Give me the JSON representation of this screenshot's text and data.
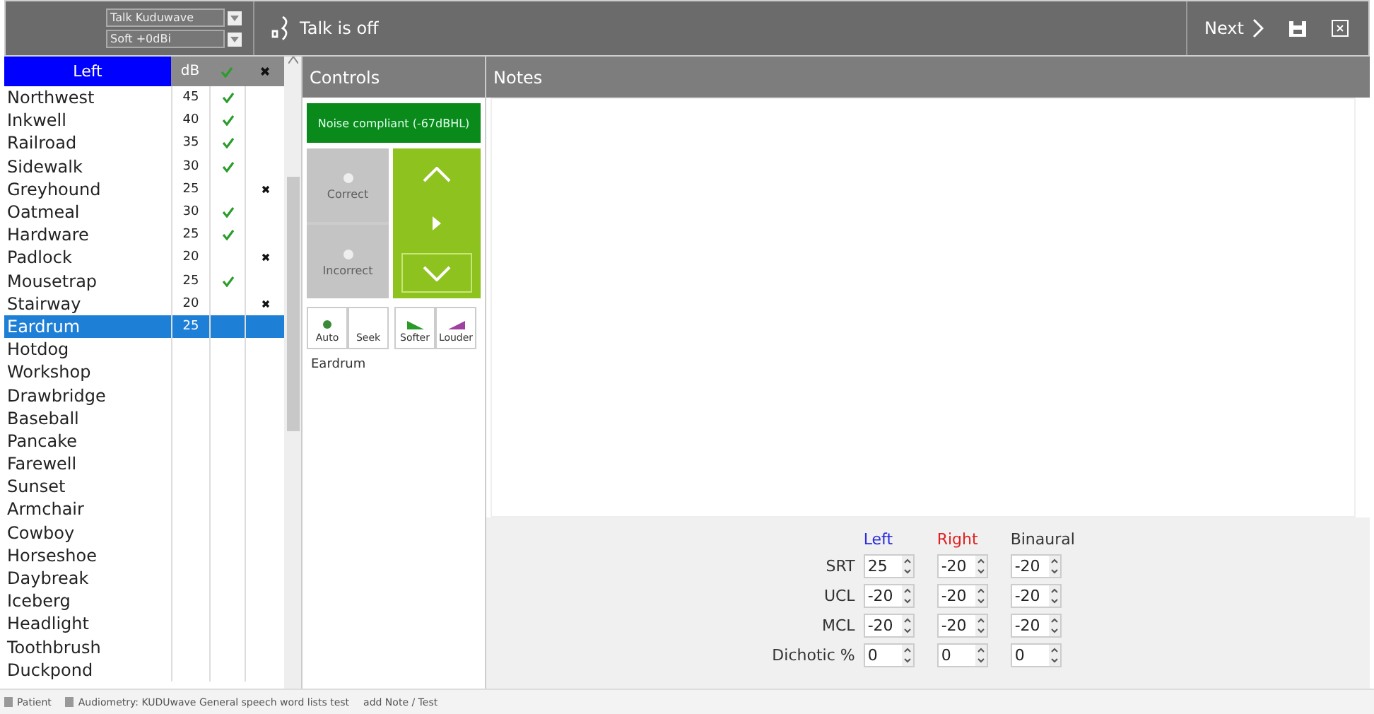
{
  "toolbar": {
    "dropdowns": [
      {
        "value": "Talk Kuduwave"
      },
      {
        "value": "Soft +0dBi"
      }
    ],
    "talk_status": "Talk is off",
    "next": "Next"
  },
  "word_list": {
    "ear": "Left",
    "db_column": "dB",
    "rows": [
      {
        "word": "Northwest",
        "db": "45",
        "correct": true,
        "selected": false
      },
      {
        "word": "Inkwell",
        "db": "40",
        "correct": true,
        "selected": false
      },
      {
        "word": "Railroad",
        "db": "35",
        "correct": true,
        "selected": false
      },
      {
        "word": "Sidewalk",
        "db": "30",
        "correct": true,
        "selected": false
      },
      {
        "word": "Greyhound",
        "db": "25",
        "correct": false,
        "selected": false
      },
      {
        "word": "Oatmeal",
        "db": "30",
        "correct": true,
        "selected": false
      },
      {
        "word": "Hardware",
        "db": "25",
        "correct": true,
        "selected": false
      },
      {
        "word": "Padlock",
        "db": "20",
        "correct": false,
        "selected": false
      },
      {
        "word": "Mousetrap",
        "db": "25",
        "correct": true,
        "selected": false
      },
      {
        "word": "Stairway",
        "db": "20",
        "correct": false,
        "selected": false
      },
      {
        "word": "Eardrum",
        "db": "25",
        "selected": true
      },
      {
        "word": "Hotdog",
        "selected": false
      },
      {
        "word": "Workshop",
        "selected": false
      },
      {
        "word": "Drawbridge",
        "selected": false
      },
      {
        "word": "Baseball",
        "selected": false
      },
      {
        "word": "Pancake",
        "selected": false
      },
      {
        "word": "Farewell",
        "selected": false
      },
      {
        "word": "Sunset",
        "selected": false
      },
      {
        "word": "Armchair",
        "selected": false
      },
      {
        "word": "Cowboy",
        "selected": false
      },
      {
        "word": "Horseshoe",
        "selected": false
      },
      {
        "word": "Daybreak",
        "selected": false
      },
      {
        "word": "Iceberg",
        "selected": false
      },
      {
        "word": "Headlight",
        "selected": false
      },
      {
        "word": "Toothbrush",
        "selected": false
      },
      {
        "word": "Duckpond",
        "selected": false
      }
    ]
  },
  "controls": {
    "title": "Controls",
    "noise_status": "Noise compliant (-67dBHL)",
    "answer_buttons": [
      {
        "label": "Correct",
        "disabled": true
      },
      {
        "label": "Incorrect",
        "disabled": true
      }
    ],
    "modes": [
      {
        "label": "Auto"
      },
      {
        "label": "Seek"
      }
    ],
    "levels": [
      {
        "label": "Softer"
      },
      {
        "label": "Louder"
      }
    ],
    "current_word": "Eardrum"
  },
  "notes": {
    "title": "Notes"
  },
  "thresholds": {
    "columns": [
      {
        "label": "Left",
        "color": "#2a2ae0"
      },
      {
        "label": "Right",
        "color": "#e02020"
      },
      {
        "label": "Binaural",
        "color": "#333333"
      }
    ],
    "rows": [
      {
        "label": "SRT",
        "values": [
          "25",
          "-20",
          "-20"
        ]
      },
      {
        "label": "UCL",
        "values": [
          "-20",
          "-20",
          "-20"
        ]
      },
      {
        "label": "MCL",
        "values": [
          "-20",
          "-20",
          "-20"
        ]
      },
      {
        "label": "Dichotic %",
        "values": [
          "0",
          "0",
          "0"
        ]
      }
    ]
  },
  "status_bar": [
    {
      "label": "Patient"
    },
    {
      "label": "Audiometry: KUDUwave General speech word lists test"
    },
    {
      "label": "add Note / Test"
    }
  ]
}
